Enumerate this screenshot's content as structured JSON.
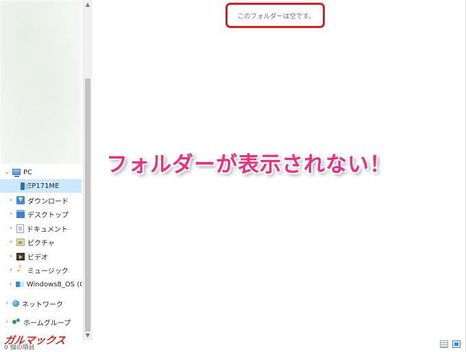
{
  "nav": {
    "items": [
      {
        "label": "PC",
        "icon": "pc-icon",
        "expanded": true,
        "selected": false
      },
      {
        "label": "EP171ME",
        "icon": "drive-icon",
        "expanded": false,
        "selected": true
      },
      {
        "label": "ダウンロード",
        "icon": "download-folder-icon",
        "expanded": false,
        "selected": false
      },
      {
        "label": "デスクトップ",
        "icon": "desktop-folder-icon",
        "expanded": false,
        "selected": false
      },
      {
        "label": "ドキュメント",
        "icon": "documents-folder-icon",
        "expanded": false,
        "selected": false
      },
      {
        "label": "ピクチャ",
        "icon": "pictures-folder-icon",
        "expanded": false,
        "selected": false
      },
      {
        "label": "ビデオ",
        "icon": "videos-folder-icon",
        "expanded": false,
        "selected": false
      },
      {
        "label": "ミュージック",
        "icon": "music-folder-icon",
        "expanded": false,
        "selected": false
      },
      {
        "label": "Windows8_OS (C",
        "icon": "windows-drive-icon",
        "expanded": false,
        "selected": false
      },
      {
        "label": "ネットワーク",
        "icon": "network-icon",
        "expanded": false,
        "selected": false
      },
      {
        "label": "ホームグループ",
        "icon": "homegroup-icon",
        "expanded": false,
        "selected": false
      }
    ]
  },
  "main": {
    "empty_message": "このフォルダーは空です。",
    "caption": "フォルダーが表示されない！"
  },
  "status_bar": {
    "item_count": "0 個の項目"
  },
  "watermark": {
    "text": "ガルマックス"
  },
  "colors": {
    "highlight": "#e8141c",
    "caption": "#ef2d7a",
    "selection": "#cce8ff",
    "logo": "#e01d1d"
  }
}
